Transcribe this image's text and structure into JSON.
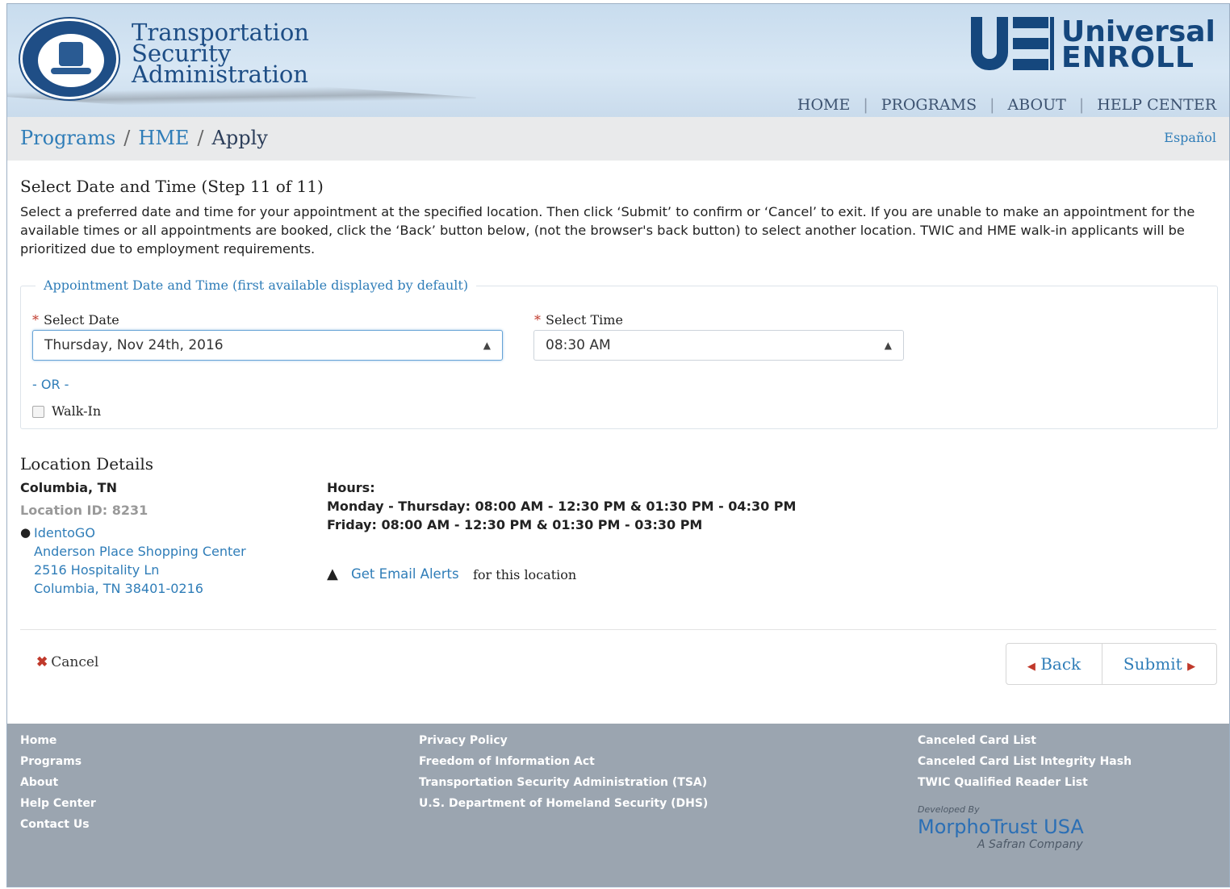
{
  "header": {
    "agency": [
      "Transportation",
      "Security",
      "Administration"
    ],
    "brand_line1": "Universal",
    "brand_line2": "ENROLL",
    "nav": [
      "HOME",
      "PROGRAMS",
      "ABOUT",
      "HELP CENTER"
    ]
  },
  "breadcrumb": {
    "items": [
      "Programs",
      "HME",
      "Apply"
    ],
    "language_link": "Español"
  },
  "step": {
    "title": "Select Date and Time (Step 11 of 11)",
    "instructions": "Select a preferred date and time for your appointment at the specified location. Then click ‘Submit’ to confirm or ‘Cancel’ to exit. If you are unable to make an appointment for the available times or all appointments are booked, click the ‘Back’ button below, (not the browser's back button) to select another location. TWIC and HME walk-in applicants will be prioritized due to employment requirements."
  },
  "appointment": {
    "legend": "Appointment Date and Time (first available displayed by default)",
    "date_label": "Select Date",
    "date_value": "Thursday, Nov 24th, 2016",
    "time_label": "Select Time",
    "time_value": "08:30 AM",
    "required_marker": "*",
    "or_text": "- OR -",
    "walkin_label": "Walk-In",
    "walkin_checked": false
  },
  "location": {
    "heading": "Location Details",
    "city": "Columbia, TN",
    "location_id": "Location ID: 8231",
    "provider": "IdentoGO",
    "address": [
      "Anderson Place Shopping Center",
      "2516 Hospitality Ln",
      "Columbia, TN 38401-0216"
    ],
    "hours_heading": "Hours:",
    "hours": [
      "Monday - Thursday: 08:00 AM - 12:30 PM & 01:30 PM - 04:30 PM",
      "Friday: 08:00 AM - 12:30 PM & 01:30 PM - 03:30 PM"
    ],
    "alerts_link": "Get Email Alerts",
    "alerts_suffix": "for this location"
  },
  "actions": {
    "cancel": "Cancel",
    "back": "Back",
    "submit": "Submit"
  },
  "footer": {
    "col1": [
      "Home",
      "Programs",
      "About",
      "Help Center",
      "Contact Us"
    ],
    "col2": [
      "Privacy Policy",
      "Freedom of Information Act",
      "Transportation Security Administration (TSA)",
      "U.S. Department of Homeland Security (DHS)"
    ],
    "col3": [
      "Canceled Card List",
      "Canceled Card List Integrity Hash",
      "TWIC Qualified Reader List"
    ],
    "developed_by": "Developed By",
    "developer": "MorphoTrust USA",
    "developer_tagline": "A Safran Company"
  },
  "colors": {
    "link": "#2f7db8",
    "brand_navy": "#15477d",
    "required": "#c0392b",
    "footer_bg": "#9ba5b0"
  }
}
